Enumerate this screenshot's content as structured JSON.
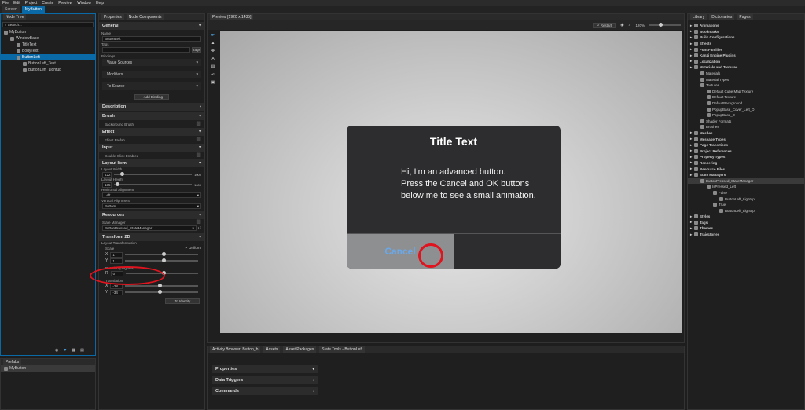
{
  "menu": [
    "File",
    "Edit",
    "Project",
    "Create",
    "Preview",
    "Window",
    "Help"
  ],
  "tabs": [
    "Screen",
    "MyButton"
  ],
  "node_tree": {
    "tab": "Node Tree",
    "search_placeholder": "Search...",
    "items": [
      {
        "label": "MyButton",
        "indent": 0
      },
      {
        "label": "WindowBase",
        "indent": 1
      },
      {
        "label": "TitleText",
        "indent": 2
      },
      {
        "label": "BodyText",
        "indent": 2
      },
      {
        "label": "ButtonLeft",
        "indent": 2,
        "selected": true
      },
      {
        "label": "ButtonLeft_Text",
        "indent": 3
      },
      {
        "label": "ButtonLeft_Lightup",
        "indent": 3
      }
    ]
  },
  "prefabs": {
    "tab": "Prefabs",
    "item": "MyButton"
  },
  "properties": {
    "tabs": [
      "Properties",
      "Node Components"
    ],
    "general": "General",
    "name_label": "Name",
    "name_value": "ButtonLeft",
    "tags_label": "Tags",
    "tags_button": "Tags",
    "bindings_label": "Bindings",
    "value_sources": "Value Sources",
    "modifiers": "Modifiers",
    "to_source": "To Source",
    "add_binding": "+ Add Binding",
    "description": "Description",
    "brush": "Brush",
    "background_brush": "Background Brush",
    "effect": "Effect",
    "effect_prefab": "Effect Prefab",
    "input": "Input",
    "double_click": "Double-Click Enabled",
    "layout_item": "Layout Item",
    "layout_width": "Layout Width",
    "layout_width_value": "422",
    "layout_width_max": "1000",
    "layout_height": "Layout Height",
    "layout_height_value": "135",
    "layout_height_max": "1000",
    "horizontal_alignment": "Horizontal Alignment",
    "horizontal_value": "Left",
    "vertical_alignment": "Vertical Alignment",
    "vertical_value": "Bottom",
    "resources": "Resources",
    "state_manager": "State Manager",
    "state_manager_value": "ButtonPressed_StateManager",
    "transform": "Transform 2D",
    "layout_transformation": "Layout Transformation",
    "scale": "Scale",
    "uniform": "Uniform",
    "scale_x": "1",
    "scale_y": "1",
    "rotation": "Rotation (degrees)",
    "rotation_value": "0",
    "translation": "Translation",
    "trans_x": "-28",
    "trans_y": "-34",
    "to_identity": "To Identity"
  },
  "preview": {
    "tab": "Preview [1920 x 1435]",
    "restart": "Restart",
    "zoom": "120%",
    "dialog_title": "Title Text",
    "dialog_body": [
      "Hi, I'm an advanced button.",
      "Press the Cancel and OK buttons",
      "below me to see a small animation."
    ],
    "cancel": "Cancel"
  },
  "bottom": {
    "tabs": [
      "Activity Browser: Button_b",
      "Assets",
      "Asset Packages",
      "State Tools - ButtonLeft"
    ],
    "sections": [
      "Properties",
      "Data Triggers",
      "Commands"
    ]
  },
  "library": {
    "tabs": [
      "Library",
      "Dictionaries",
      "Pages"
    ],
    "items": [
      {
        "label": "Animations",
        "indent": 0,
        "bold": true
      },
      {
        "label": "Bookmarks",
        "indent": 0,
        "bold": true
      },
      {
        "label": "Build Configurations",
        "indent": 0,
        "bold": true
      },
      {
        "label": "Effects",
        "indent": 0,
        "bold": true
      },
      {
        "label": "Font Families",
        "indent": 0,
        "bold": true
      },
      {
        "label": "Kanzi Engine Plugins",
        "indent": 0,
        "bold": true
      },
      {
        "label": "Localization",
        "indent": 0,
        "bold": true
      },
      {
        "label": "Materials and Textures",
        "indent": 0,
        "bold": true
      },
      {
        "label": "Materials",
        "indent": 1
      },
      {
        "label": "Material Types",
        "indent": 1
      },
      {
        "label": "Textures",
        "indent": 1
      },
      {
        "label": "Default Cube Map Texture",
        "indent": 2
      },
      {
        "label": "Default Texture",
        "indent": 2
      },
      {
        "label": "DefaultBackground",
        "indent": 2
      },
      {
        "label": "PopupBase_Cover_Left_D",
        "indent": 2
      },
      {
        "label": "PopupBase_D",
        "indent": 2
      },
      {
        "label": "Shader Formats",
        "indent": 1
      },
      {
        "label": "Brushes",
        "indent": 1
      },
      {
        "label": "Meshes",
        "indent": 0,
        "bold": true
      },
      {
        "label": "Message Types",
        "indent": 0,
        "bold": true
      },
      {
        "label": "Page Transitions",
        "indent": 0,
        "bold": true
      },
      {
        "label": "Project References",
        "indent": 0,
        "bold": true
      },
      {
        "label": "Property Types",
        "indent": 0,
        "bold": true
      },
      {
        "label": "Rendering",
        "indent": 0,
        "bold": true
      },
      {
        "label": "Resource Files",
        "indent": 0,
        "bold": true
      },
      {
        "label": "State Managers",
        "indent": 0,
        "bold": true
      },
      {
        "label": "ButtonPressed_StateManager",
        "indent": 1,
        "selected": true
      },
      {
        "label": "IsPressed_Left",
        "indent": 2
      },
      {
        "label": "False",
        "indent": 3
      },
      {
        "label": "ButtonLeft_Lightup",
        "indent": 4
      },
      {
        "label": "True",
        "indent": 3
      },
      {
        "label": "ButtonLeft_Lightup",
        "indent": 4
      },
      {
        "label": "Styles",
        "indent": 0,
        "bold": true
      },
      {
        "label": "Tags",
        "indent": 0,
        "bold": true
      },
      {
        "label": "Themes",
        "indent": 0,
        "bold": true
      },
      {
        "label": "Trajectories",
        "indent": 0,
        "bold": true
      }
    ]
  },
  "colors": {
    "accent": "#0a6aa7",
    "highlight": "#e0141e"
  }
}
